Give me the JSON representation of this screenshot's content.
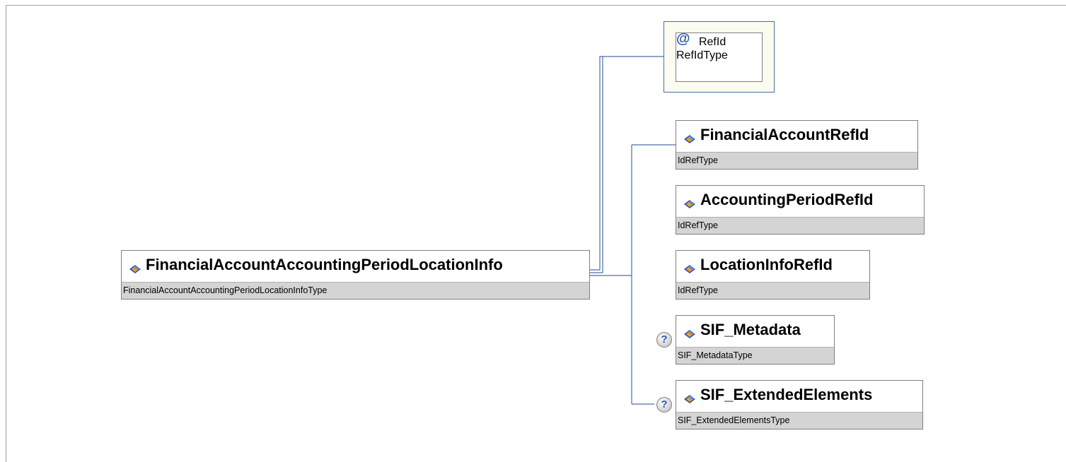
{
  "root": {
    "name": "FinancialAccountAccountingPeriodLocationInfo",
    "type": "FinancialAccountAccountingPeriodLocationInfoType"
  },
  "attribute": {
    "name": "RefId",
    "type": "RefIdType",
    "icon": "at-icon"
  },
  "elements": [
    {
      "name": "FinancialAccountRefId",
      "type": "IdRefType",
      "optional": false
    },
    {
      "name": "AccountingPeriodRefId",
      "type": "IdRefType",
      "optional": false
    },
    {
      "name": "LocationInfoRefId",
      "type": "IdRefType",
      "optional": false
    },
    {
      "name": "SIF_Metadata",
      "type": "SIF_MetadataType",
      "optional": true
    },
    {
      "name": "SIF_ExtendedElements",
      "type": "SIF_ExtendedElementsType",
      "optional": true
    }
  ],
  "optional_marker": "?",
  "colors": {
    "connector": "#4a6fa5",
    "type_bar": "#d4d4d4",
    "attribute_bg": "#fbfbf0",
    "icon_blue": "#2a57b0",
    "icon_orange": "#f0a020"
  }
}
